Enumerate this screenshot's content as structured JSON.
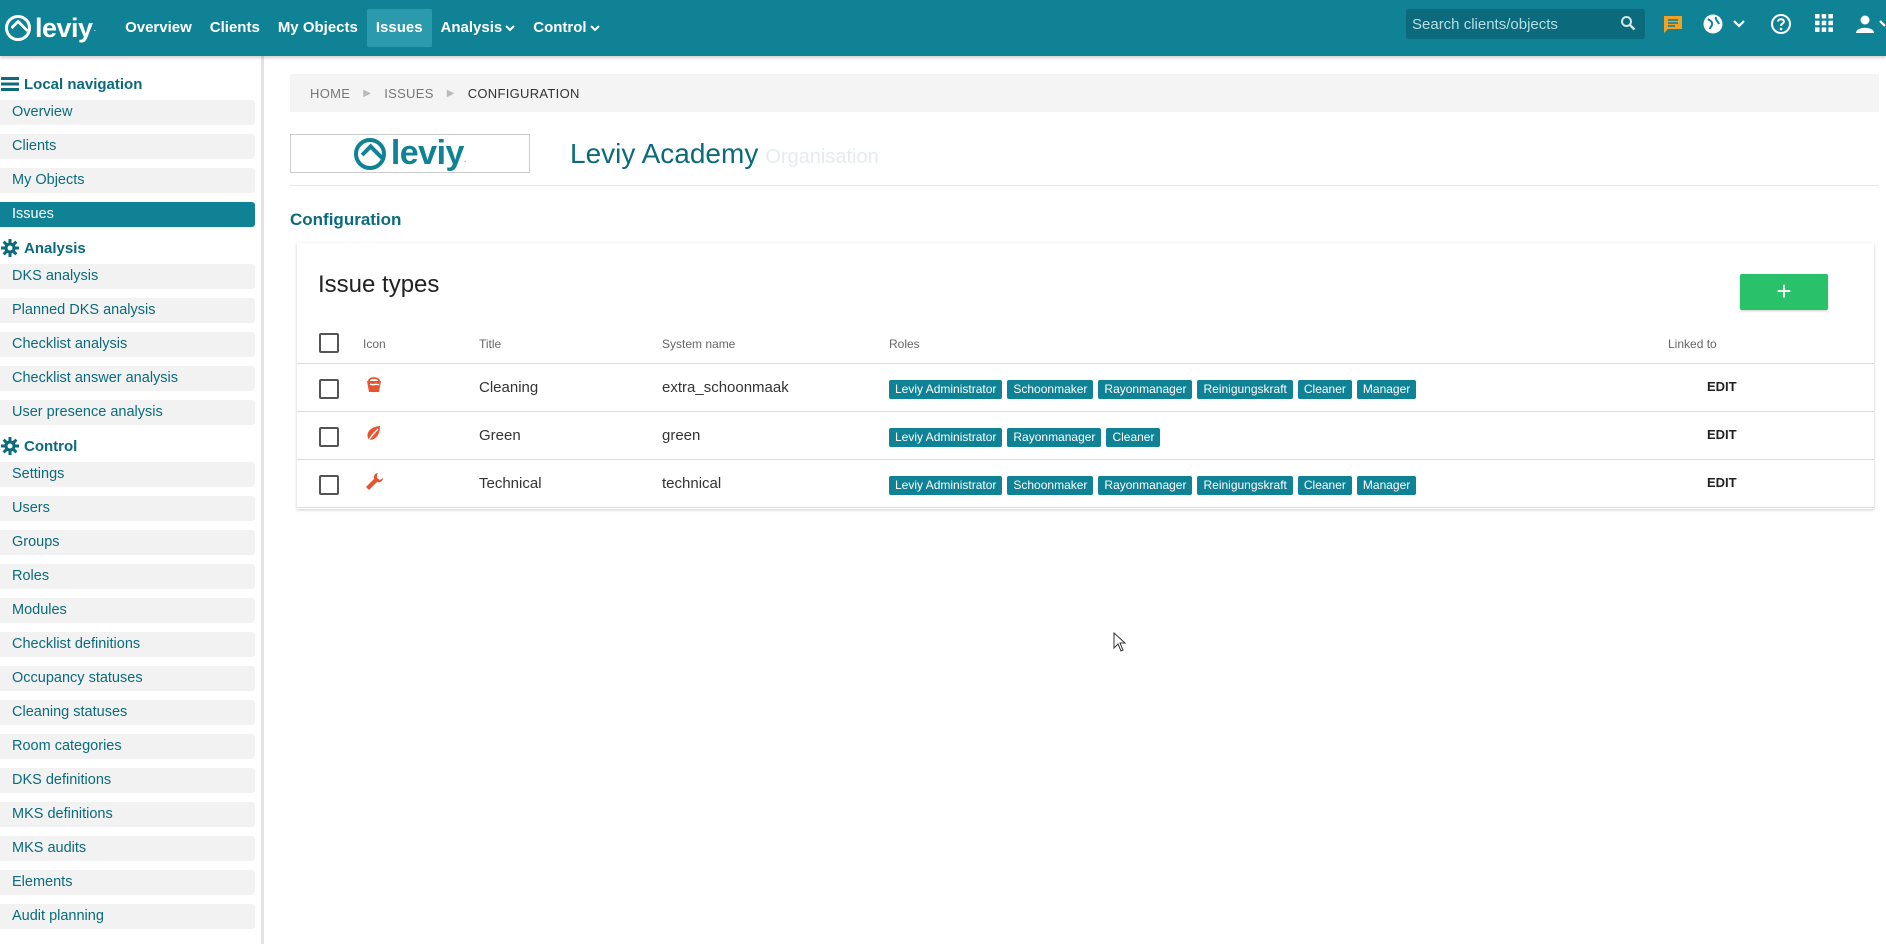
{
  "topbar": {
    "logo_text": "leviy",
    "logo_dot": ".",
    "nav": [
      {
        "label": "Overview"
      },
      {
        "label": "Clients"
      },
      {
        "label": "My Objects"
      },
      {
        "label": "Issues",
        "active": true
      },
      {
        "label": "Analysis",
        "has_dropdown": true
      },
      {
        "label": "Control",
        "has_dropdown": true
      }
    ],
    "search_placeholder": "Search clients/objects",
    "icons": [
      "search-icon",
      "chat-icon",
      "globe-icon",
      "help-icon",
      "apps-grid-icon",
      "user-icon"
    ]
  },
  "sidebar": {
    "sections": [
      {
        "heading": "Local navigation",
        "icon": "menu-icon",
        "items": [
          "Overview",
          "Clients",
          "My Objects",
          "Issues"
        ],
        "active": "Issues"
      },
      {
        "heading": "Analysis",
        "icon": "gear-icon",
        "items": [
          "DKS analysis",
          "Planned DKS analysis",
          "Checklist analysis",
          "Checklist answer analysis",
          "User presence analysis"
        ]
      },
      {
        "heading": "Control",
        "icon": "gear-icon",
        "items": [
          "Settings",
          "Users",
          "Groups",
          "Roles",
          "Modules",
          "Checklist definitions",
          "Occupancy statuses",
          "Cleaning statuses",
          "Room categories",
          "DKS definitions",
          "MKS definitions",
          "MKS audits",
          "Elements",
          "Audit planning"
        ]
      }
    ]
  },
  "breadcrumb": {
    "items": [
      "HOME",
      "ISSUES",
      "CONFIGURATION"
    ]
  },
  "organisation": {
    "logo_text": "leviy",
    "name": "Leviy Academy",
    "subtitle": "Organisation"
  },
  "section_title": "Configuration",
  "issue_types": {
    "title": "Issue types",
    "add_label": "+",
    "columns": {
      "icon": "Icon",
      "title": "Title",
      "system_name": "System name",
      "roles": "Roles",
      "linked_to": "Linked to"
    },
    "rows": [
      {
        "icon": "bucket-icon",
        "title": "Cleaning",
        "system_name": "extra_schoonmaak",
        "roles": [
          "Leviy Administrator",
          "Schoonmaker",
          "Rayonmanager",
          "Reinigungskraft",
          "Cleaner",
          "Manager"
        ],
        "action": "EDIT"
      },
      {
        "icon": "leaf-icon",
        "title": "Green",
        "system_name": "green",
        "roles": [
          "Leviy Administrator",
          "Rayonmanager",
          "Cleaner"
        ],
        "action": "EDIT"
      },
      {
        "icon": "wrench-icon",
        "title": "Technical",
        "system_name": "technical",
        "roles": [
          "Leviy Administrator",
          "Schoonmaker",
          "Rayonmanager",
          "Reinigungskraft",
          "Cleaner",
          "Manager"
        ],
        "action": "EDIT"
      }
    ]
  },
  "colors": {
    "brand": "#0f8296",
    "brand_dark": "#0b6b7c",
    "add_button": "#29c16a",
    "issue_icon": "#e8542f"
  }
}
